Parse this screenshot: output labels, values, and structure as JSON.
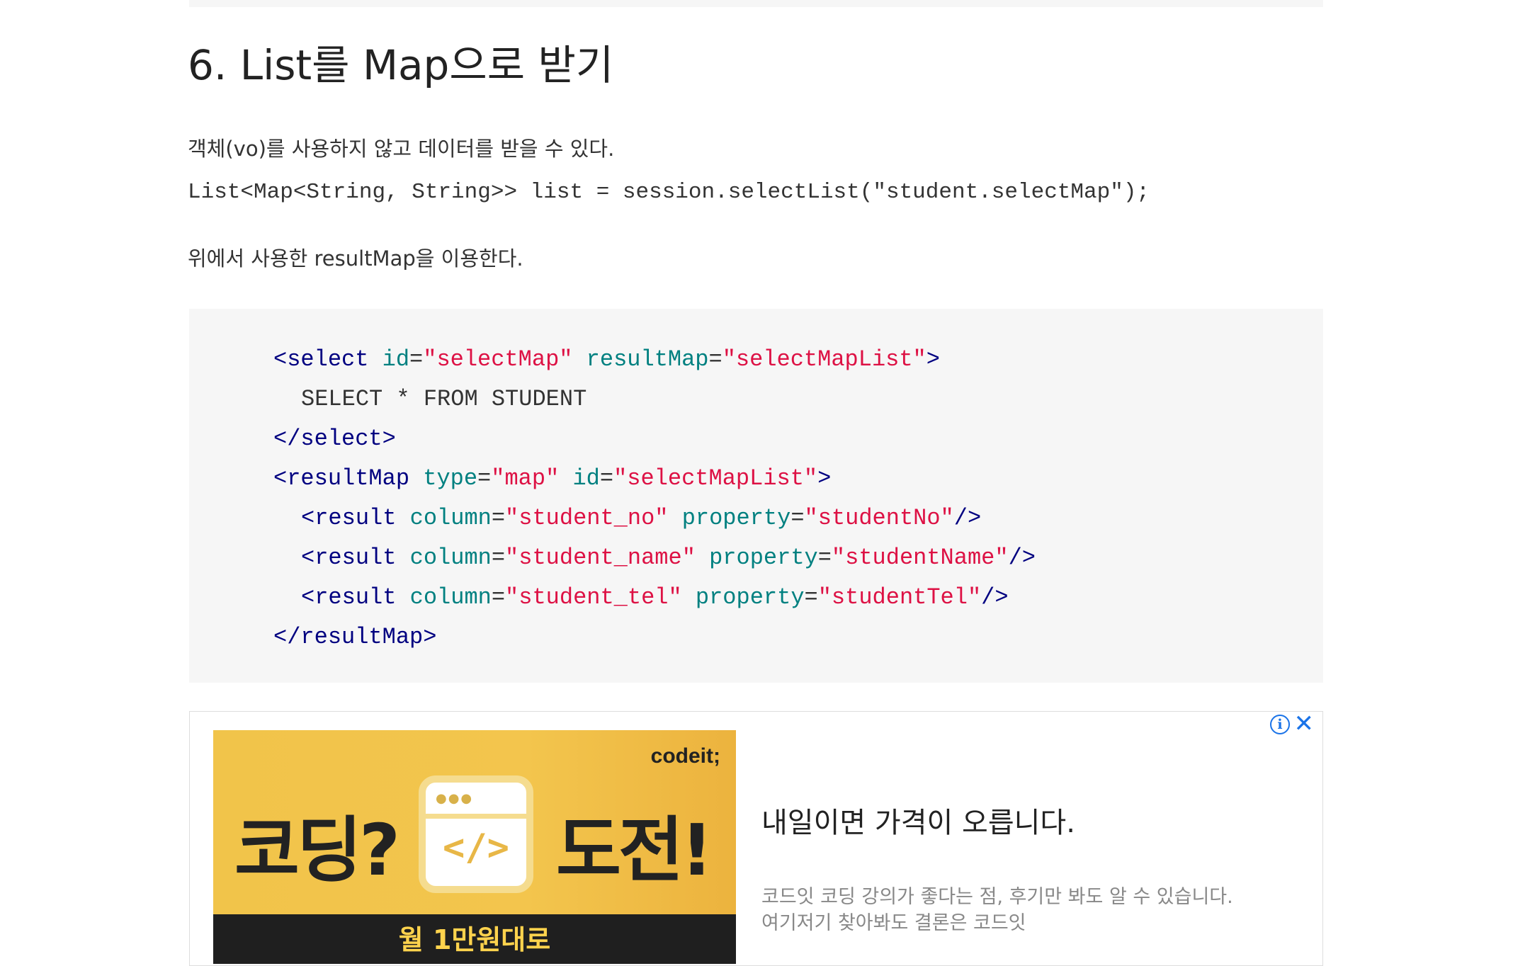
{
  "article": {
    "heading": "6. List를 Map으로 받기",
    "para1": "객체(vo)를 사용하지 않고 데이터를 받을 수 있다.",
    "inline_code": "List<Map<String, String>> list = session.selectList(\"student.selectMap\");",
    "para2": "위에서 사용한 resultMap을 이용한다."
  },
  "code": {
    "l1": {
      "open": "<select",
      "a1": "id",
      "v1": "\"selectMap\"",
      "a2": "resultMap",
      "v2": "\"selectMapList\"",
      "close": ">"
    },
    "l2": {
      "text": "SELECT * FROM STUDENT"
    },
    "l3": {
      "tag": "</select>"
    },
    "l4": {
      "open": "<resultMap",
      "a1": "type",
      "v1": "\"map\"",
      "a2": "id",
      "v2": "\"selectMapList\"",
      "close": ">"
    },
    "l5": {
      "open": "<result",
      "a1": "column",
      "v1": "\"student_no\"",
      "a2": "property",
      "v2": "\"studentNo\"",
      "close": "/>"
    },
    "l6": {
      "open": "<result",
      "a1": "column",
      "v1": "\"student_name\"",
      "a2": "property",
      "v2": "\"studentName\"",
      "close": "/>"
    },
    "l7": {
      "open": "<result",
      "a1": "column",
      "v1": "\"student_tel\"",
      "a2": "property",
      "v2": "\"studentTel\"",
      "close": "/>"
    },
    "l8": {
      "tag": "</resultMap>"
    }
  },
  "ad": {
    "brand": "codeit;",
    "hero_left": "코딩?",
    "hero_right": "도전!",
    "window_code": "</>",
    "strip": "월 1만원대로",
    "headline": "내일이면 가격이 오릅니다.",
    "desc1": "코드잇 코딩 강의가 좋다는 점, 후기만 봐도 알 수 있습니다.",
    "desc2": "여기저기 찾아봐도 결론은 코드잇",
    "info_glyph": "i",
    "close_glyph": "✕"
  }
}
